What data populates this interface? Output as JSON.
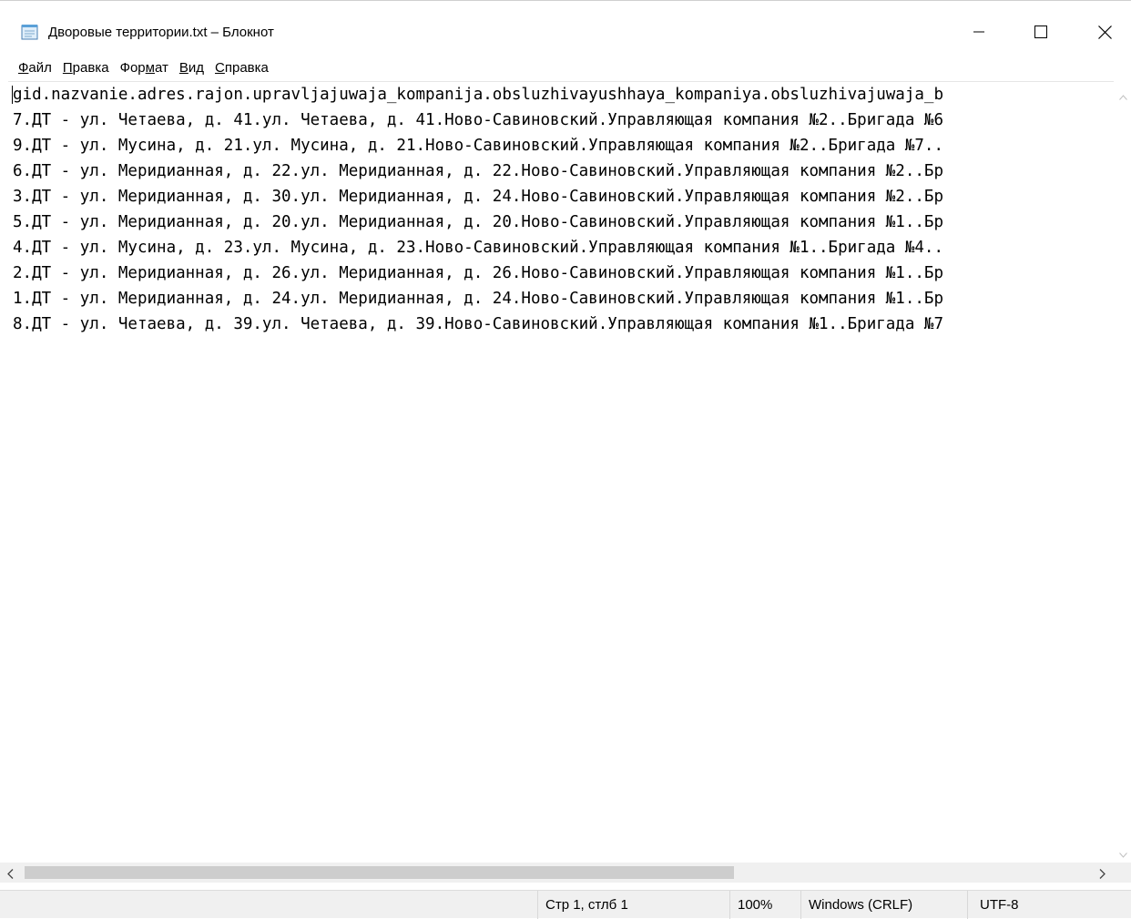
{
  "window": {
    "title": "Дворовые территории.txt – Блокнот",
    "app_icon": "notepad-icon"
  },
  "menu": [
    {
      "hotkey": "Ф",
      "rest": "айл"
    },
    {
      "hotkey": "П",
      "rest": "равка"
    },
    {
      "pre": "Фор",
      "hotkey": "м",
      "rest": "ат"
    },
    {
      "hotkey": "В",
      "rest": "ид"
    },
    {
      "hotkey": "С",
      "rest": "правка"
    }
  ],
  "document": {
    "lines": [
      "gid.nazvanie.adres.rajon.upravljajuwaja_kompanija.obsluzhivayushhaya_kompaniya.obsluzhivajuwaja_b",
      "7.ДТ - ул. Четаева, д. 41.ул. Четаева, д. 41.Ново-Савиновский.Управляющая компания №2..Бригада №6",
      "9.ДТ - ул. Мусина, д. 21.ул. Мусина, д. 21.Ново-Савиновский.Управляющая компания №2..Бригада №7..",
      "6.ДТ - ул. Меридианная, д. 22.ул. Меридианная, д. 22.Ново-Савиновский.Управляющая компания №2..Бр",
      "3.ДТ - ул. Меридианная, д. 30.ул. Меридианная, д. 24.Ново-Савиновский.Управляющая компания №2..Бр",
      "5.ДТ - ул. Меридианная, д. 20.ул. Меридианная, д. 20.Ново-Савиновский.Управляющая компания №1..Бр",
      "4.ДТ - ул. Мусина, д. 23.ул. Мусина, д. 23.Ново-Савиновский.Управляющая компания №1..Бригада №4..",
      "2.ДТ - ул. Меридианная, д. 26.ул. Меридианная, д. 26.Ново-Савиновский.Управляющая компания №1..Бр",
      "1.ДТ - ул. Меридианная, д. 24.ул. Меридианная, д. 24.Ново-Савиновский.Управляющая компания №1..Бр",
      "8.ДТ - ул. Четаева, д. 39.ул. Четаева, д. 39.Ново-Савиновский.Управляющая компания №1..Бригада №7"
    ]
  },
  "status": {
    "position": "Стр 1, стлб 1",
    "zoom": "100%",
    "line_ending": "Windows (CRLF)",
    "encoding": "UTF-8"
  },
  "colors": {
    "statusbar_bg": "#f0f0f0",
    "scroll_thumb": "#cdcdcd"
  }
}
